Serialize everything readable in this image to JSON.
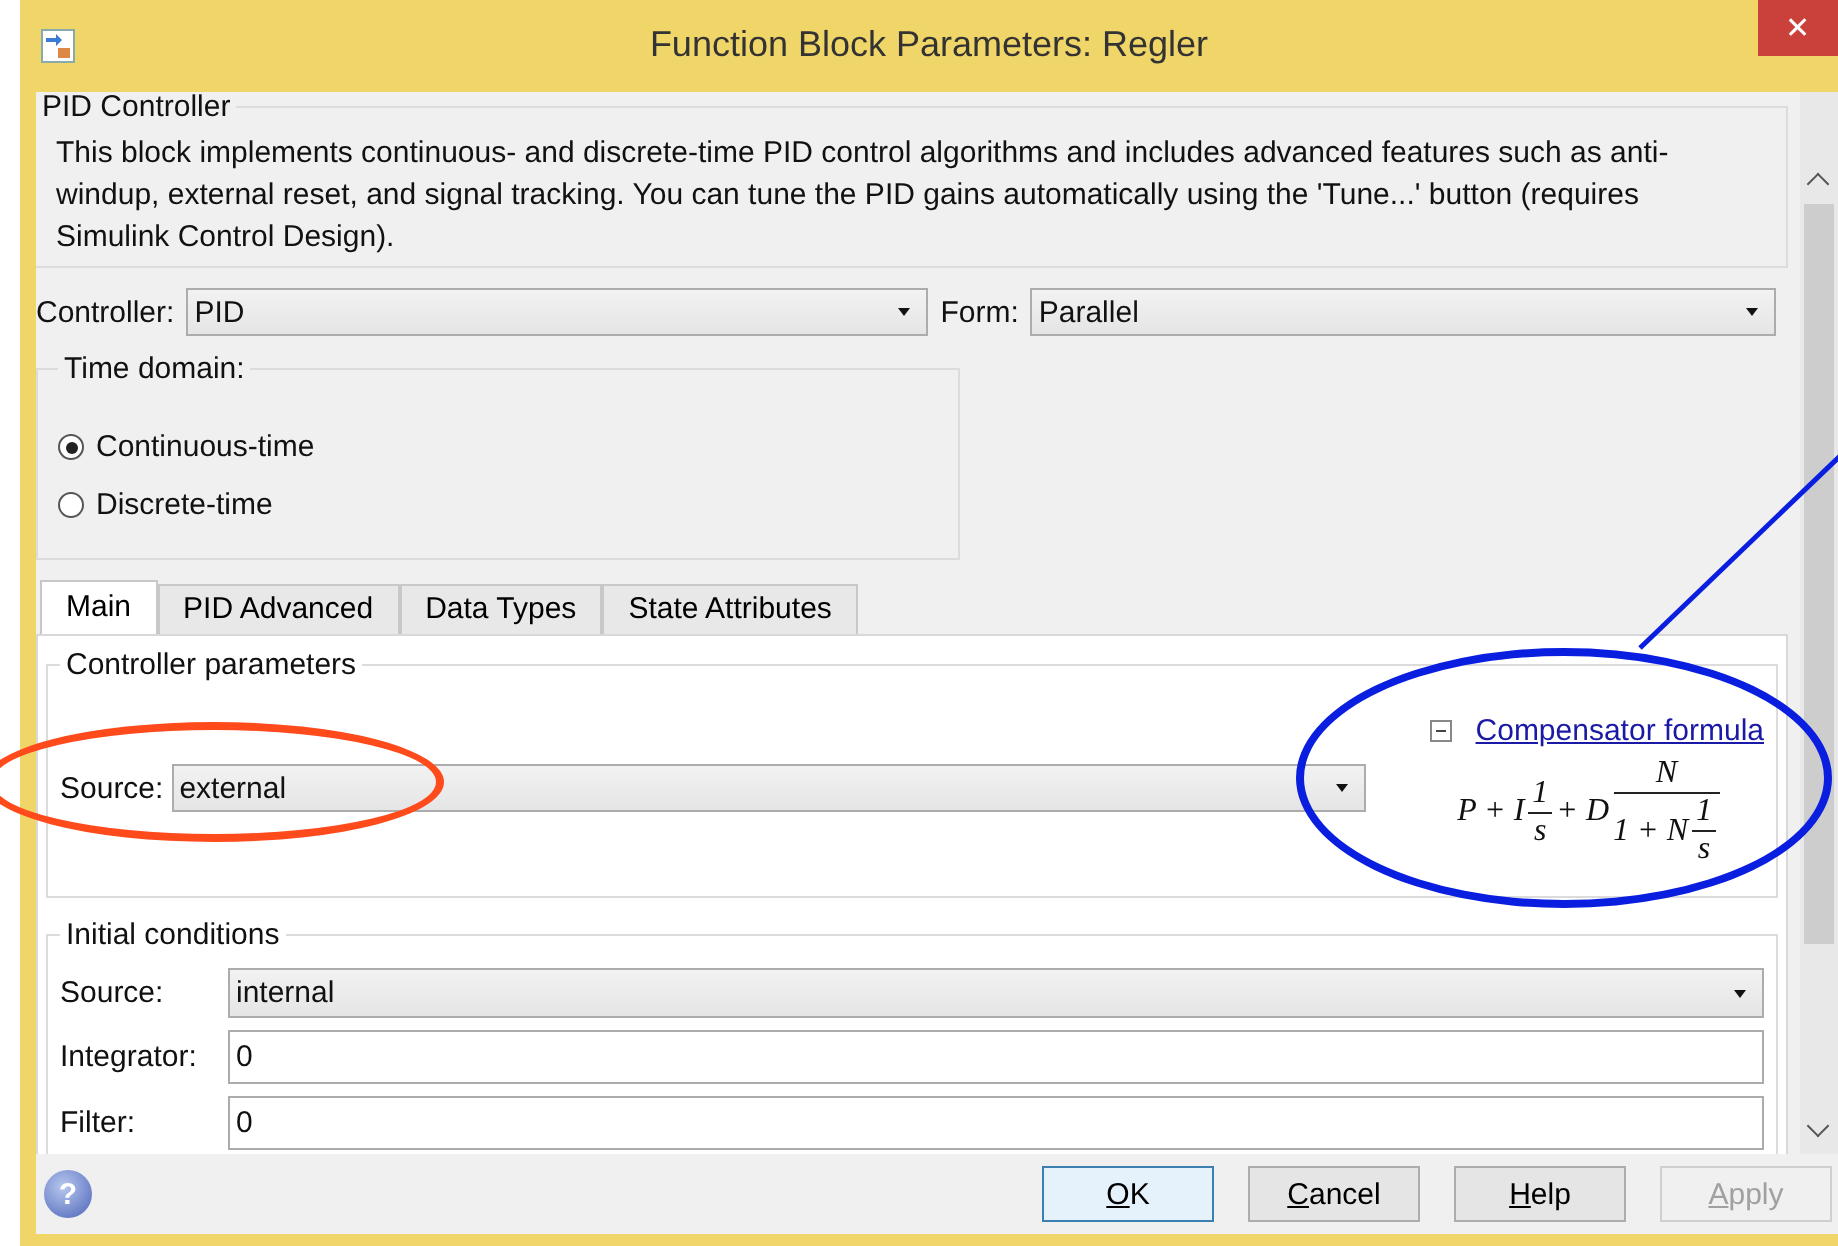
{
  "window": {
    "title": "Function Block Parameters: Regler",
    "close": "✕"
  },
  "block": {
    "title": "PID Controller",
    "description": "This block implements continuous- and discrete-time PID control algorithms and includes advanced features such as anti-windup, external reset, and signal tracking. You can tune the PID gains automatically using the 'Tune...' button (requires Simulink Control Design)."
  },
  "controller": {
    "label": "Controller:",
    "value": "PID"
  },
  "form": {
    "label": "Form:",
    "value": "Parallel"
  },
  "time_domain": {
    "title": "Time domain:",
    "options": [
      {
        "label": "Continuous-time",
        "selected": true
      },
      {
        "label": "Discrete-time",
        "selected": false
      }
    ]
  },
  "tabs": [
    {
      "label": "Main",
      "selected": true
    },
    {
      "label": "PID Advanced",
      "selected": false
    },
    {
      "label": "Data Types",
      "selected": false
    },
    {
      "label": "State Attributes",
      "selected": false
    }
  ],
  "controller_parameters": {
    "title": "Controller parameters",
    "source_label": "Source:",
    "source_value": "external",
    "formula_link": "Compensator formula",
    "formula_expanded": true,
    "formula": [
      {
        "kind": "text",
        "text": "P + I"
      },
      {
        "kind": "frac",
        "num": [
          {
            "kind": "text",
            "text": "1"
          }
        ],
        "den": [
          {
            "kind": "text",
            "text": "s"
          }
        ]
      },
      {
        "kind": "text",
        "text": "+ D"
      },
      {
        "kind": "frac",
        "num": [
          {
            "kind": "text",
            "text": "N"
          }
        ],
        "den": [
          {
            "kind": "text",
            "text": "1 + N"
          },
          {
            "kind": "frac",
            "num": [
              {
                "kind": "text",
                "text": "1"
              }
            ],
            "den": [
              {
                "kind": "text",
                "text": "s"
              }
            ]
          }
        ]
      }
    ]
  },
  "initial_conditions": {
    "title": "Initial conditions",
    "fields": [
      {
        "kind": "dropdown",
        "label": "Source:",
        "value": "internal"
      },
      {
        "kind": "input",
        "label": "Integrator:",
        "value": "0"
      },
      {
        "kind": "input",
        "label": "Filter:",
        "value": "0"
      }
    ]
  },
  "help_icon": "?",
  "buttons": [
    {
      "label": "OK",
      "default": true,
      "disabled": false
    },
    {
      "label": "Cancel",
      "default": false,
      "disabled": false
    },
    {
      "label": "Help",
      "default": false,
      "disabled": false
    },
    {
      "label": "Apply",
      "default": false,
      "disabled": true
    }
  ],
  "annotations": [
    {
      "kind": "ellipse",
      "color": "#ff4a1c"
    },
    {
      "kind": "ellipse",
      "color": "#0a1ee0"
    },
    {
      "kind": "line",
      "color": "#0a1ee0"
    }
  ]
}
